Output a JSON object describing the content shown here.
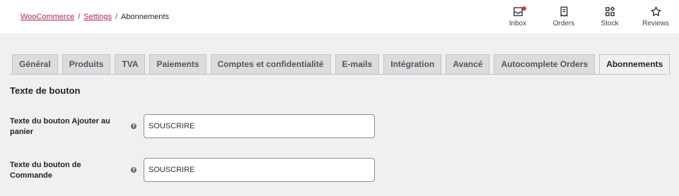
{
  "breadcrumb": {
    "woocommerce": "WooCommerce",
    "settings": "Settings",
    "current": "Abonnements",
    "separator": "/"
  },
  "header_buttons": [
    {
      "label": "Inbox",
      "icon": "inbox-icon",
      "has_badge": true
    },
    {
      "label": "Orders",
      "icon": "orders-icon"
    },
    {
      "label": "Stock",
      "icon": "stock-icon"
    },
    {
      "label": "Reviews",
      "icon": "star-icon"
    }
  ],
  "tabs": [
    {
      "label": "Général"
    },
    {
      "label": "Produits"
    },
    {
      "label": "TVA"
    },
    {
      "label": "Paiements"
    },
    {
      "label": "Comptes et confidentialité"
    },
    {
      "label": "E-mails"
    },
    {
      "label": "Intégration"
    },
    {
      "label": "Avancé"
    },
    {
      "label": "Autocomplete Orders"
    },
    {
      "label": "Abonnements",
      "active": true
    }
  ],
  "section": {
    "title": "Texte de bouton"
  },
  "fields": {
    "add_to_cart": {
      "label": "Texte du bouton Ajouter au panier",
      "value": "SOUSCRIRE",
      "help": "?"
    },
    "order": {
      "label": "Texte du bouton de Commande",
      "value": "SOUSCRIRE",
      "help": "?"
    }
  },
  "colors": {
    "link": "#b5215d",
    "background": "#f0f0f1",
    "badge": "#d63638"
  }
}
